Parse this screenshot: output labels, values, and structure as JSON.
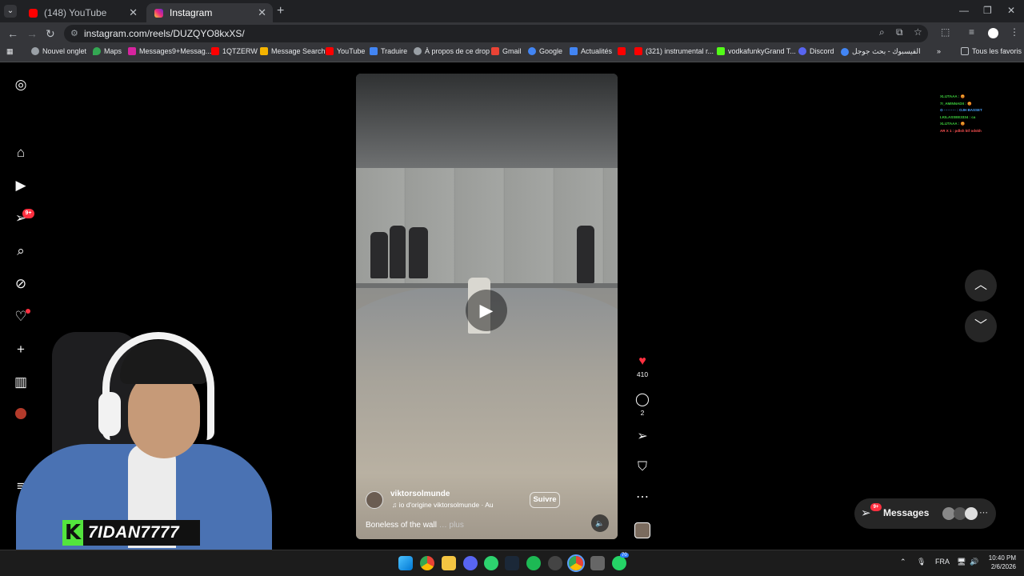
{
  "browser": {
    "tabs": [
      {
        "title": "(148) YouTube",
        "active": false,
        "icon": "youtube-icon"
      },
      {
        "title": "Instagram",
        "active": true,
        "icon": "instagram-icon"
      }
    ],
    "url": "instagram.com/reels/DUZQYO8kxXS/",
    "bookmarks": [
      {
        "label": "Nouvel onglet",
        "icon": "globe-icon",
        "color": "#9aa0a6"
      },
      {
        "label": "Maps",
        "icon": "maps-icon",
        "color": "#34a853"
      },
      {
        "label": "Messages9+Messag...",
        "icon": "instagram-icon",
        "color": "#d6249f"
      },
      {
        "label": "1QTZERW",
        "icon": "youtube-icon",
        "color": "#ff0000"
      },
      {
        "label": "Message Search",
        "icon": "bars-icon",
        "color": "#f4b400"
      },
      {
        "label": "YouTube",
        "icon": "youtube-icon",
        "color": "#ff0000"
      },
      {
        "label": "Traduire",
        "icon": "translate-icon",
        "color": "#4285f4"
      },
      {
        "label": "À propos de ce drop",
        "icon": "globe-icon",
        "color": "#9aa0a6"
      },
      {
        "label": "Gmail",
        "icon": "gmail-icon",
        "color": "#ea4335"
      },
      {
        "label": "Google",
        "icon": "google-icon",
        "color": "#4285f4"
      },
      {
        "label": "Actualités",
        "icon": "news-icon",
        "color": "#4285f4"
      },
      {
        "label": "",
        "icon": "youtube-icon",
        "color": "#ff0000"
      },
      {
        "label": "(321) instrumental r...",
        "icon": "youtube-icon",
        "color": "#ff0000"
      },
      {
        "label": "vodkafunkyGrand T...",
        "icon": "kick-icon",
        "color": "#53fc18"
      },
      {
        "label": "Discord",
        "icon": "discord-icon",
        "color": "#5865f2"
      },
      {
        "label": "الفيسبوك - بحث جوجل",
        "icon": "google-icon",
        "color": "#4285f4"
      }
    ],
    "all_bookmarks": "Tous les favoris"
  },
  "sidebar": {
    "notifications_badge": "9+"
  },
  "reel": {
    "username": "viktorsolmunde",
    "audio": "io d'origine   viktorsolmunde · Au",
    "follow_label": "Suivre",
    "caption": "Boneless of the wall",
    "caption_more": "… plus",
    "likes": "410",
    "comments": "2"
  },
  "messages": {
    "label": "Messages",
    "badge": "9+"
  },
  "chat_overlay": [
    {
      "text": "XLIJTAAA : 😡",
      "color": "#3ed13e"
    },
    {
      "text": "7I_AMINNADII : 😡",
      "color": "#3ed13e"
    },
    {
      "text": "⊙ ·········· : OJH BASSET",
      "color": "#4aa3ff"
    },
    {
      "text": "LKILASSEE3334 : ca",
      "color": "#3ed13e"
    },
    {
      "text": "XLIJTAAA : 😡",
      "color": "#3ed13e"
    },
    {
      "text": "AR X 1 : pdlsh ktf odskh",
      "color": "#ff5252"
    }
  ],
  "streamer": {
    "name": "7IDAN7777",
    "logo_letter": "K"
  },
  "taskbar": {
    "language": "FRA",
    "time": "10:40 PM",
    "date": "2/6/2026",
    "app_badge": "70"
  }
}
